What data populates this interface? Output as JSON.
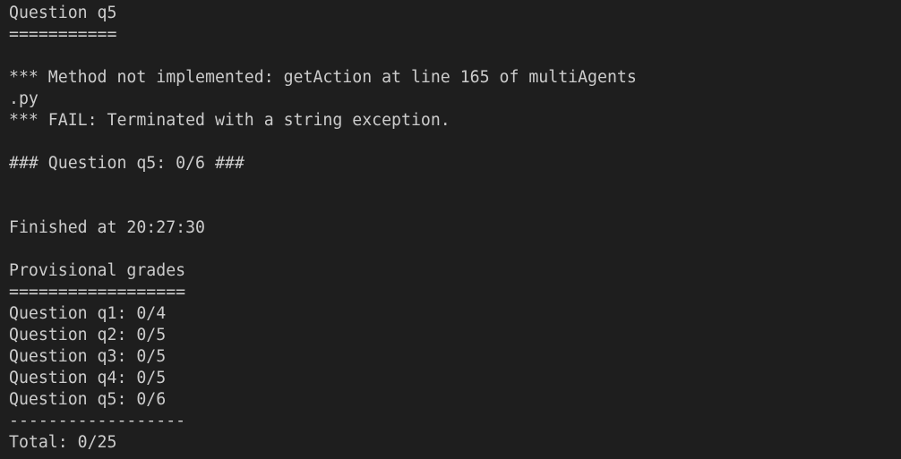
{
  "terminal": {
    "lines": [
      "Question q5",
      "===========",
      "",
      "*** Method not implemented: getAction at line 165 of multiAgents",
      ".py",
      "*** FAIL: Terminated with a string exception.",
      "",
      "### Question q5: 0/6 ###",
      "",
      "",
      "Finished at 20:27:30",
      "",
      "Provisional grades",
      "==================",
      "Question q1: 0/4",
      "Question q2: 0/5",
      "Question q3: 0/5",
      "Question q4: 0/5",
      "Question q5: 0/6",
      "------------------",
      "Total: 0/25"
    ]
  }
}
